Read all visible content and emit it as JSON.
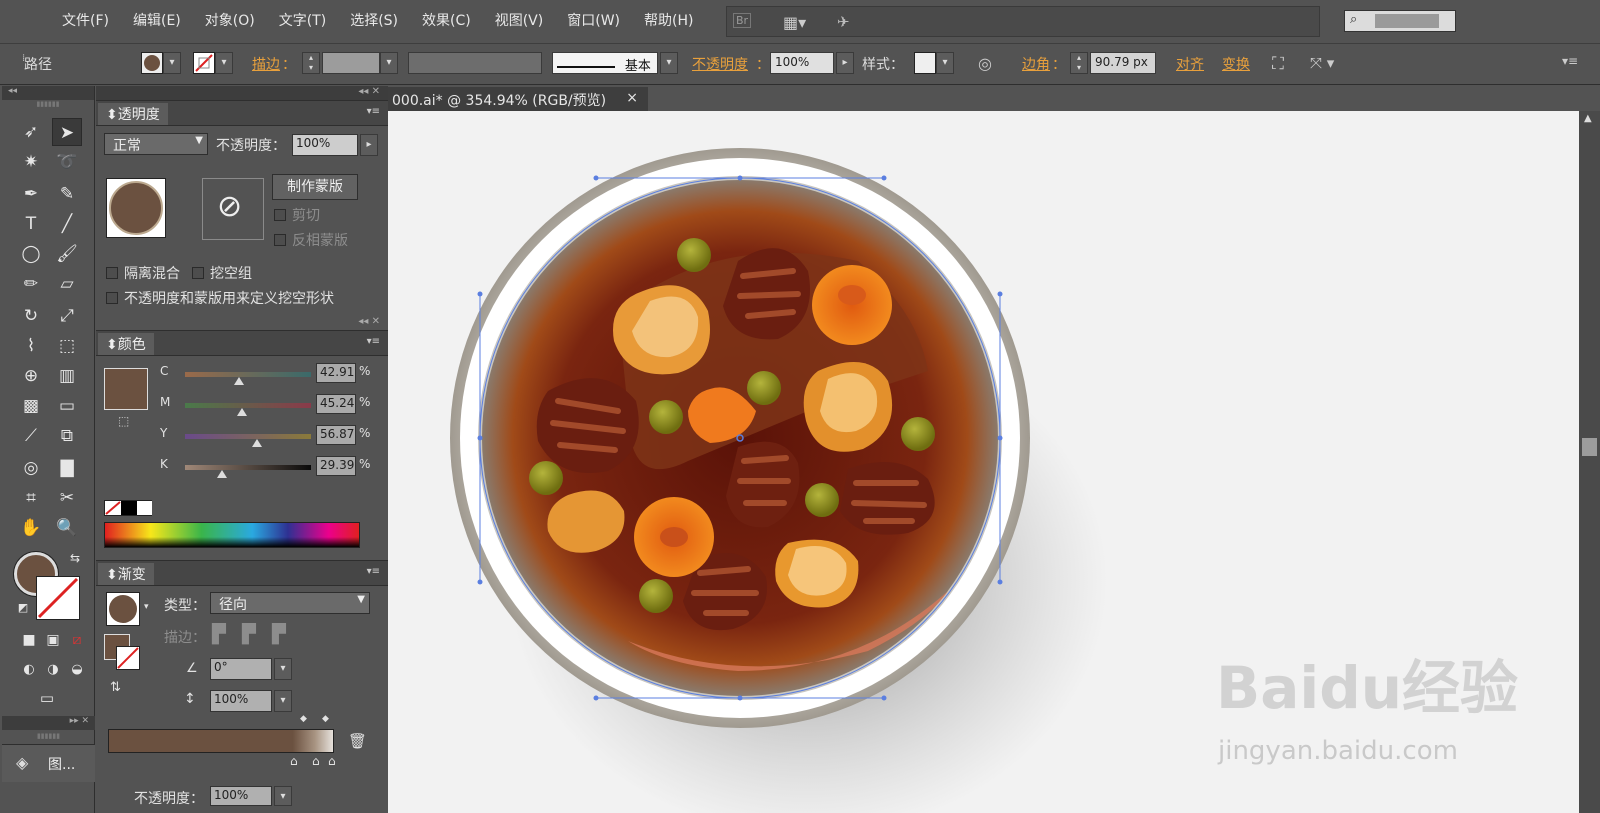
{
  "menu": [
    "文件(F)",
    "编辑(E)",
    "对象(O)",
    "文字(T)",
    "选择(S)",
    "效果(C)",
    "视图(V)",
    "窗口(W)",
    "帮助(H)"
  ],
  "topbar": {
    "bridge": "Br"
  },
  "control": {
    "object_type": "路径",
    "stroke_label": "描边",
    "stroke_colon": "：",
    "brush_label": "基本",
    "opacity_label": "不透明度",
    "opacity_value": "100%",
    "style_label": "样式：",
    "corner_label": "边角",
    "corner_value": "90.79 px",
    "align_label": "对齐",
    "transform_label": "变换"
  },
  "transparency_panel": {
    "title": "透明度",
    "mode": "正常",
    "opacity_label": "不透明度：",
    "opacity_value": "100%",
    "make_mask": "制作蒙版",
    "clip": "剪切",
    "invert_mask": "反相蒙版",
    "isolate_blending": "隔离混合",
    "knockout_group": "挖空组",
    "opacity_mask_define": "不透明度和蒙版用来定义挖空形状"
  },
  "color_panel": {
    "title": "颜色",
    "channels": [
      {
        "name": "C",
        "value": "42.91",
        "pos": 0.43
      },
      {
        "name": "M",
        "value": "45.24",
        "pos": 0.45
      },
      {
        "name": "Y",
        "value": "56.87",
        "pos": 0.57
      },
      {
        "name": "K",
        "value": "29.39",
        "pos": 0.29
      }
    ],
    "unit": "%",
    "swatch_color": "#6b5140"
  },
  "gradient_panel": {
    "title": "渐变",
    "type_label": "类型：",
    "type_value": "径向",
    "stroke_label": "描边：",
    "angle_value": "0°",
    "ratio_value": "100%",
    "opacity_label": "不透明度：",
    "opacity_value": "100%"
  },
  "layers_panel": {
    "label": "图..."
  },
  "document": {
    "tab": "000.ai* @ 354.94% (RGB/预览)",
    "close": "×"
  },
  "watermark": {
    "main": "Baidu经验",
    "sub": "jingyan.baidu.com"
  }
}
